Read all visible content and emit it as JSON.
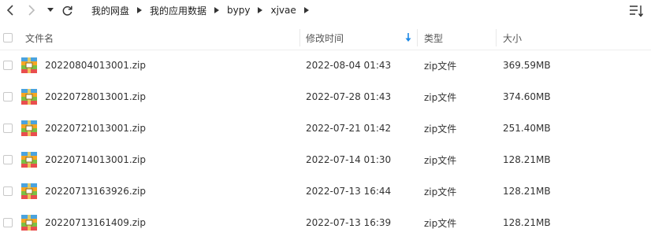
{
  "breadcrumb": [
    "我的网盘",
    "我的应用数据",
    "bypy",
    "xjvae"
  ],
  "columns": {
    "name": "文件名",
    "modified": "修改时间",
    "type": "类型",
    "size": "大小"
  },
  "sort": {
    "column": "modified",
    "direction": "desc"
  },
  "files": [
    {
      "name": "20220804013001.zip",
      "modified": "2022-08-04 01:43",
      "type": "zip文件",
      "size": "369.59MB"
    },
    {
      "name": "20220728013001.zip",
      "modified": "2022-07-28 01:43",
      "type": "zip文件",
      "size": "374.60MB"
    },
    {
      "name": "20220721013001.zip",
      "modified": "2022-07-21 01:42",
      "type": "zip文件",
      "size": "251.40MB"
    },
    {
      "name": "20220714013001.zip",
      "modified": "2022-07-14 01:30",
      "type": "zip文件",
      "size": "128.21MB"
    },
    {
      "name": "20220713163926.zip",
      "modified": "2022-07-13 16:44",
      "type": "zip文件",
      "size": "128.21MB"
    },
    {
      "name": "20220713161409.zip",
      "modified": "2022-07-13 16:39",
      "type": "zip文件",
      "size": "128.21MB"
    }
  ],
  "icons": {
    "back": "chevron-left-icon",
    "forward": "chevron-right-icon",
    "history": "caret-down-icon",
    "refresh": "refresh-icon",
    "sort": "sort-list-icon",
    "file": "zip-archive-icon"
  },
  "colors": {
    "sort_arrow": "#1e88e5",
    "zip_blue": "#4aa3df",
    "zip_orange": "#f5a623",
    "zip_green": "#7bc043",
    "zip_red": "#e94e4e"
  }
}
